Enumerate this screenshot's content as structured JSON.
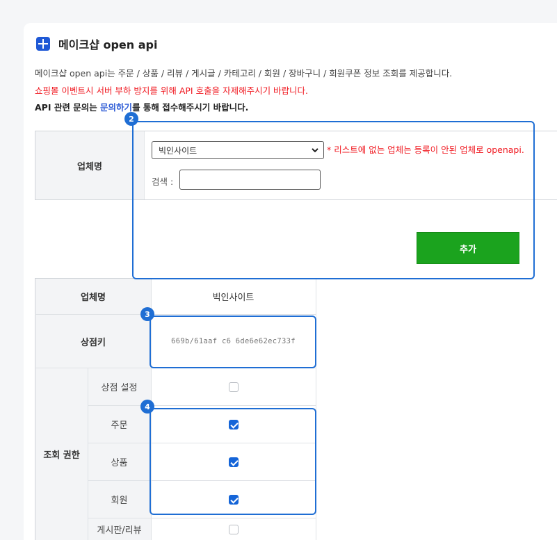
{
  "header": {
    "title": "메이크샵 open api",
    "desc1": "메이크샵 open api는 주문 / 상품 / 리뷰 / 게시글 / 카테고리 / 회원 / 장바구니 / 회원쿠폰 정보 조회를 제공합니다.",
    "desc2": "쇼핑몰 이벤트시 서버 부하 방지를 위해 API 호출을 자제해주시기 바랍니다.",
    "desc3_prefix": "API 관련 문의는 ",
    "desc3_link": "문의하기",
    "desc3_suffix": "를 통해 접수해주시기 바랍니다."
  },
  "form": {
    "vendor_label": "업체명",
    "vendor_selected": "빅인사이트",
    "notice": "* 리스트에 없는 업체는 등록이 안된 업체로 openapi.",
    "search_label": "검색 :",
    "search_value": "",
    "add_button": "추가"
  },
  "badges": {
    "b2": "2",
    "b3": "3",
    "b4": "4"
  },
  "detail": {
    "vendor_label": "업체명",
    "vendor_value": "빅인사이트",
    "store_key_label": "상점키",
    "store_key_value": "669b/61aaf c6 6de6e62ec733f",
    "perm_label": "조회 권한",
    "permissions": [
      {
        "label": "상점 설정",
        "checked": false
      },
      {
        "label": "주문",
        "checked": true
      },
      {
        "label": "상품",
        "checked": true
      },
      {
        "label": "회원",
        "checked": true
      },
      {
        "label": "게시판/리뷰",
        "checked": false
      }
    ]
  },
  "colors": {
    "accent_blue": "#1f6ed4",
    "warning_red": "#f0171f",
    "button_green": "#1ba31e",
    "link_blue": "#2d5bd6"
  }
}
